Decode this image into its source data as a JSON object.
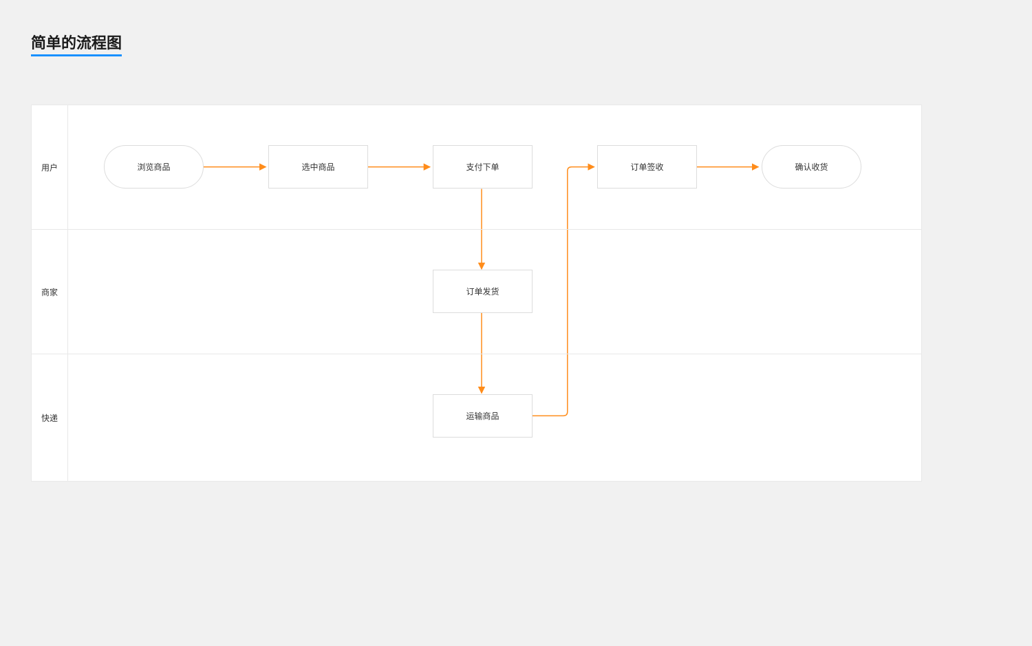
{
  "title": "简单的流程图",
  "lanes": {
    "user": "用户",
    "merchant": "商家",
    "courier": "快递"
  },
  "nodes": {
    "browse": "浏览商品",
    "select": "选中商品",
    "pay": "支付下单",
    "sign": "订单签收",
    "confirm": "确认收货",
    "ship": "订单发货",
    "transport": "运输商品"
  },
  "colors": {
    "edge": "#ff8c1a",
    "accent": "#1890ff"
  }
}
